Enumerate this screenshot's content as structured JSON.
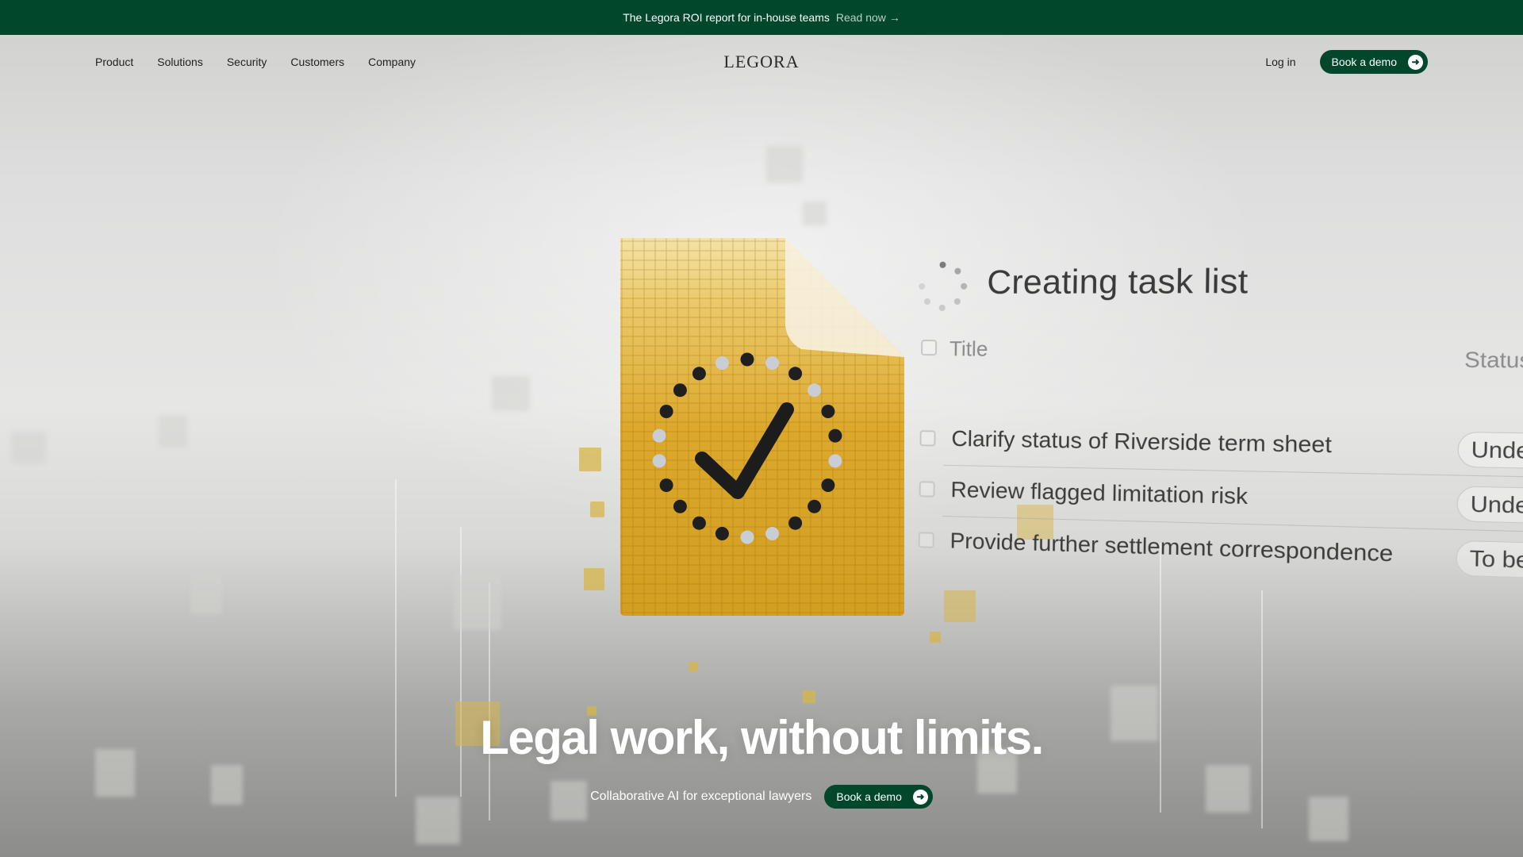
{
  "announcement": {
    "text": "The Legora ROI report for in-house teams",
    "link": "Read now",
    "link_arrow": "→"
  },
  "nav": {
    "links": [
      "Product",
      "Solutions",
      "Security",
      "Customers",
      "Company"
    ],
    "brand": "LEGORA",
    "login": "Log in",
    "cta": "Book a demo",
    "cta_icon": "arrow-right-icon"
  },
  "task_panel": {
    "title": "Creating task list",
    "columns": {
      "title": "Title",
      "status": "Status"
    },
    "tasks": [
      {
        "label": "Clarify status of Riverside term sheet",
        "status": "Under re"
      },
      {
        "label": "Review flagged limitation risk",
        "status": "Under re"
      },
      {
        "label": "Provide further settlement correspondence",
        "status": "To be pr"
      }
    ]
  },
  "hero": {
    "headline": "Legal work, without limits.",
    "tagline": "Collaborative AI for exceptional lawyers",
    "cta": "Book a demo",
    "cta_icon": "arrow-right-icon"
  },
  "colors": {
    "brand_green": "#00472b",
    "document_gold": "#d9a92a"
  }
}
